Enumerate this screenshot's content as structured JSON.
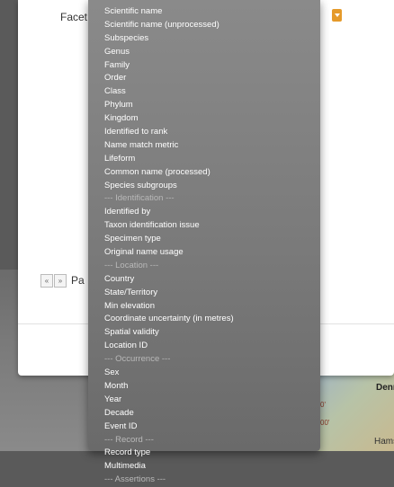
{
  "dialog": {
    "facet_label": "Facet",
    "pager_first": "«",
    "pager_prev": "»",
    "pager_text": "Pa"
  },
  "map": {
    "label_denn": "Denn",
    "label_hams": "Hams",
    "coord_a": "0'",
    "coord_b": "00'"
  },
  "dropdown": {
    "options": [
      {
        "label": "Scientific name",
        "group": false
      },
      {
        "label": "Scientific name (unprocessed)",
        "group": false
      },
      {
        "label": "Subspecies",
        "group": false
      },
      {
        "label": "Genus",
        "group": false
      },
      {
        "label": "Family",
        "group": false
      },
      {
        "label": "Order",
        "group": false
      },
      {
        "label": "Class",
        "group": false
      },
      {
        "label": "Phylum",
        "group": false
      },
      {
        "label": "Kingdom",
        "group": false
      },
      {
        "label": "Identified to rank",
        "group": false
      },
      {
        "label": "Name match metric",
        "group": false
      },
      {
        "label": "Lifeform",
        "group": false
      },
      {
        "label": "Common name (processed)",
        "group": false
      },
      {
        "label": "Species subgroups",
        "group": false
      },
      {
        "label": "--- Identification ---",
        "group": true
      },
      {
        "label": "Identified by",
        "group": false
      },
      {
        "label": "Taxon identification issue",
        "group": false
      },
      {
        "label": "Specimen type",
        "group": false
      },
      {
        "label": "Original name usage",
        "group": false
      },
      {
        "label": "--- Location ---",
        "group": true
      },
      {
        "label": "Country",
        "group": false
      },
      {
        "label": "State/Territory",
        "group": false
      },
      {
        "label": "Min elevation",
        "group": false
      },
      {
        "label": "Coordinate uncertainty (in metres)",
        "group": false
      },
      {
        "label": "Spatial validity",
        "group": false
      },
      {
        "label": "Location ID",
        "group": false
      },
      {
        "label": "--- Occurrence ---",
        "group": true
      },
      {
        "label": "Sex",
        "group": false
      },
      {
        "label": "Month",
        "group": false
      },
      {
        "label": "Year",
        "group": false
      },
      {
        "label": "Decade",
        "group": false
      },
      {
        "label": "Event ID",
        "group": false
      },
      {
        "label": "--- Record ---",
        "group": true
      },
      {
        "label": "Record type",
        "group": false
      },
      {
        "label": "Multimedia",
        "group": false
      },
      {
        "label": "--- Assertions ---",
        "group": true
      }
    ]
  }
}
